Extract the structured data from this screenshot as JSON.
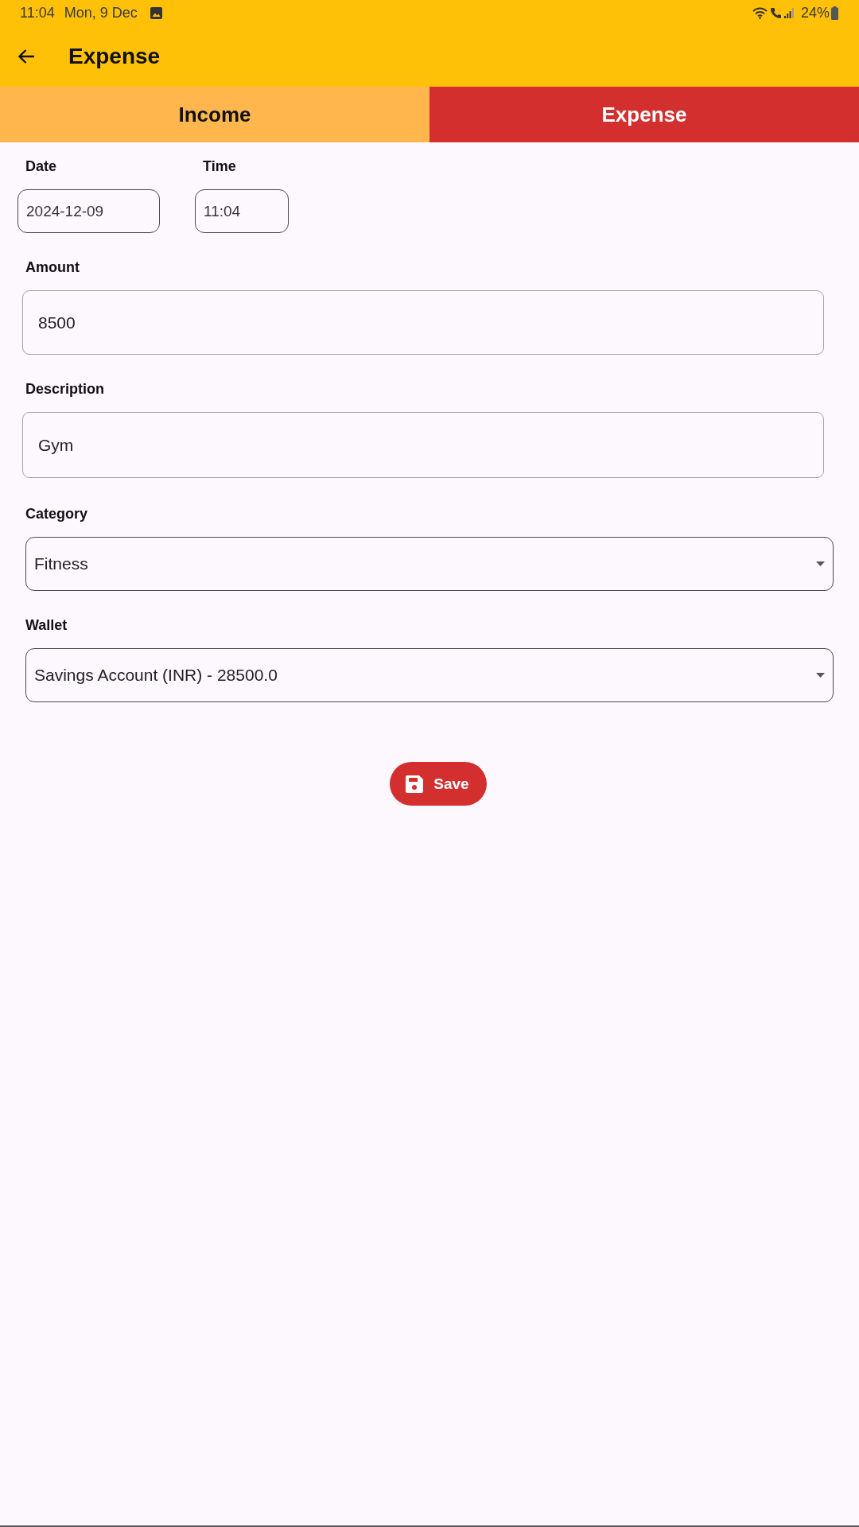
{
  "status_bar": {
    "time": "11:04",
    "date": "Mon, 9 Dec",
    "battery": "24%"
  },
  "app_bar": {
    "title": "Expense"
  },
  "tabs": [
    {
      "label": "Income",
      "selected": false
    },
    {
      "label": "Expense",
      "selected": true
    }
  ],
  "datetime_fields": [
    {
      "label": "Date",
      "value": "2024-12-09"
    },
    {
      "label": "Time",
      "value": "11:04"
    }
  ],
  "text_fields": [
    {
      "label": "Amount",
      "value": "8500"
    },
    {
      "label": "Description",
      "value": "Gym"
    }
  ],
  "dropdowns": [
    {
      "label": "Category",
      "value": "Fitness"
    },
    {
      "label": "Wallet",
      "value": "Savings Account (INR) - 28500.0"
    }
  ],
  "save_button": {
    "label": "Save"
  }
}
